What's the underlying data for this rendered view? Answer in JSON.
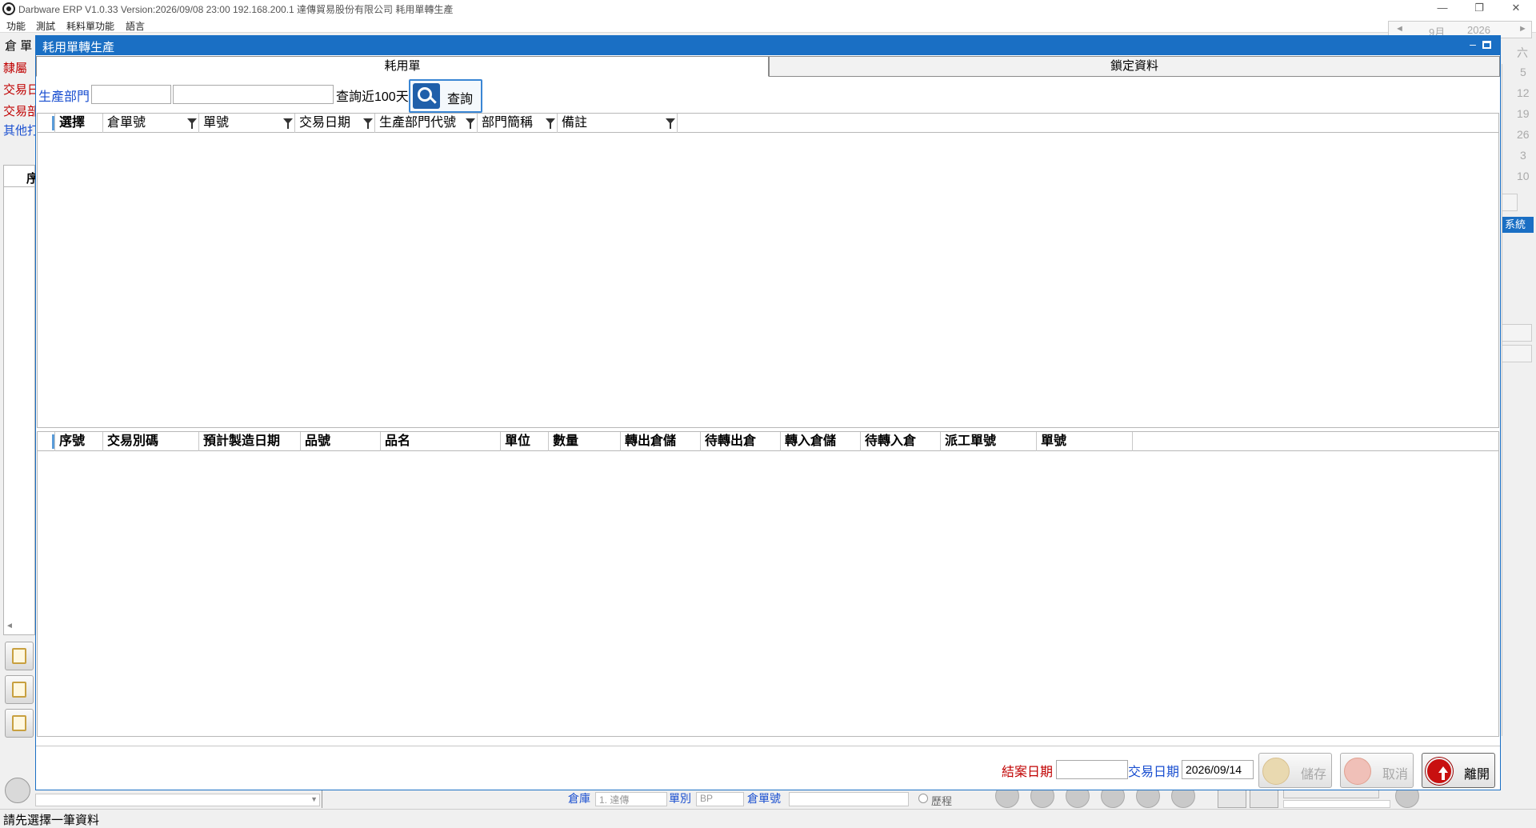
{
  "app": {
    "title": "Darbware ERP V1.0.33 Version:2026/09/08 23:00   192.168.200.1 達傳貿易股份有限公司 耗用單轉生產",
    "menu": [
      "功能",
      "測試",
      "耗料單功能",
      "語言"
    ]
  },
  "background": {
    "header_label": "倉 單",
    "left_labels": [
      "隸屬",
      "交易日",
      "交易部",
      "其他打"
    ],
    "row_header_label": "序",
    "calendar": {
      "month": "9月",
      "year": "2026",
      "days": [
        "六",
        "5",
        "12",
        "19",
        "26",
        "3",
        "10"
      ]
    },
    "side_tab": "系統",
    "bottom": {
      "warehouse_label": "倉庫",
      "warehouse_value": "1. 達傳",
      "category_label": "單別",
      "category_value": "BP",
      "doc_label": "倉單號",
      "history_label": "歷程"
    }
  },
  "dialog": {
    "title": "耗用單轉生產",
    "tabs": [
      "耗用單",
      "鎖定資料"
    ],
    "query": {
      "dept_label": "生產部門",
      "dept_code": "",
      "dept_name": "",
      "recent_label": "查詢近100天",
      "button_label": "查詢"
    },
    "top_grid": {
      "columns": [
        "選擇",
        "倉單號",
        "單號",
        "交易日期",
        "生產部門代號",
        "部門簡稱",
        "備註"
      ]
    },
    "bottom_grid": {
      "columns": [
        "序號",
        "交易別碼",
        "預計製造日期",
        "品號",
        "品名",
        "單位",
        "數量",
        "轉出倉儲",
        "待轉出倉",
        "轉入倉儲",
        "待轉入倉",
        "派工單號",
        "單號"
      ]
    },
    "footer": {
      "close_date_label": "結案日期",
      "close_date_value": "",
      "trade_date_label": "交易日期",
      "trade_date_value": "2026/09/14",
      "save_label": "儲存",
      "cancel_label": "取消",
      "exit_label": "離開"
    }
  },
  "status": {
    "message": "請先選擇一筆資料"
  },
  "colors": {
    "title_blue": "#1a6fc4",
    "label_blue": "#1a4fd0",
    "label_red": "#c00000"
  }
}
